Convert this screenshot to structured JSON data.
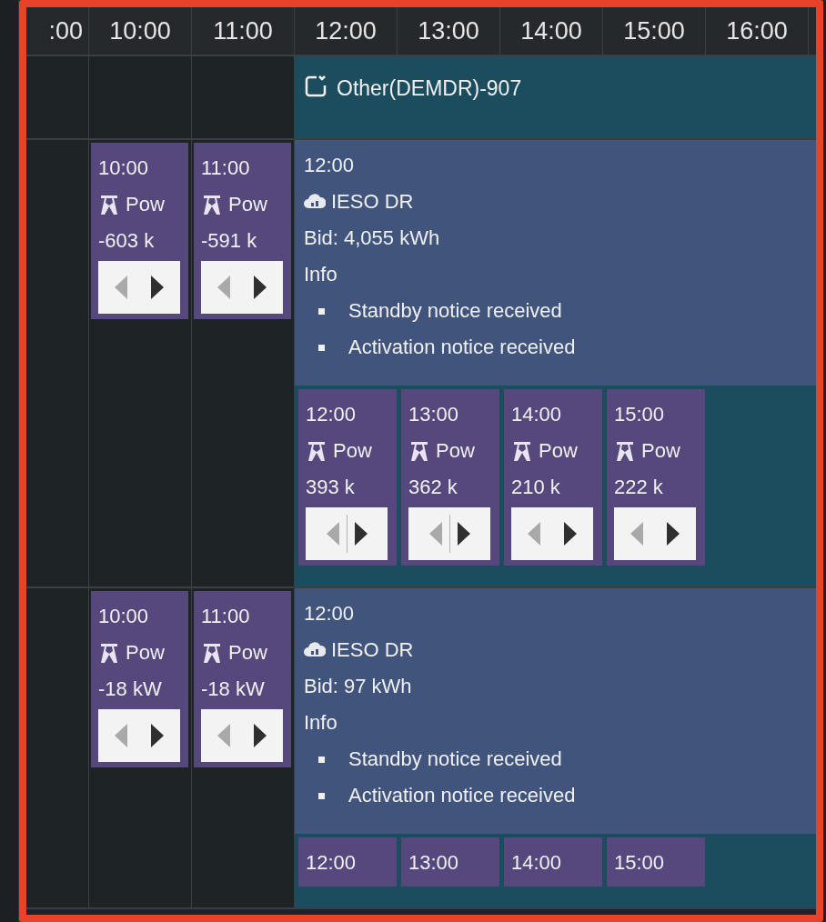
{
  "header": {
    "times": [
      ":00",
      "10:00",
      "11:00",
      "12:00",
      "13:00",
      "14:00",
      "15:00",
      "16:00"
    ]
  },
  "rows": [
    {
      "kind": "banner",
      "label": "Other(DEMDR)-907"
    },
    {
      "kind": "event",
      "pre_cards": [
        {
          "time": "10:00",
          "label": "Pow",
          "value": "-603 k",
          "nav": {
            "prev_disabled": true,
            "split": false
          }
        },
        {
          "time": "11:00",
          "label": "Pow",
          "value": "-591 k",
          "nav": {
            "prev_disabled": true,
            "split": false
          }
        }
      ],
      "event": {
        "time": "12:00",
        "name": "IESO DR",
        "bid": "Bid: 4,055 kWh",
        "info_label": "Info",
        "notes": [
          "Standby notice received",
          "Activation notice received"
        ]
      },
      "hourly": [
        {
          "time": "12:00",
          "label": "Pow",
          "value": "393 k",
          "nav": {
            "prev_disabled": true,
            "split": true
          }
        },
        {
          "time": "13:00",
          "label": "Pow",
          "value": "362 k",
          "nav": {
            "prev_disabled": true,
            "split": true
          }
        },
        {
          "time": "14:00",
          "label": "Pow",
          "value": "210 k",
          "nav": {
            "prev_disabled": true,
            "split": false
          }
        },
        {
          "time": "15:00",
          "label": "Pow",
          "value": "222 k",
          "nav": {
            "prev_disabled": true,
            "split": false
          }
        }
      ]
    },
    {
      "kind": "event",
      "pre_cards": [
        {
          "time": "10:00",
          "label": "Pow",
          "value": "-18 kW",
          "nav": {
            "prev_disabled": true,
            "split": false
          }
        },
        {
          "time": "11:00",
          "label": "Pow",
          "value": "-18 kW",
          "nav": {
            "prev_disabled": true,
            "split": false
          }
        }
      ],
      "event": {
        "time": "12:00",
        "name": "IESO DR",
        "bid": "Bid: 97 kWh",
        "info_label": "Info",
        "notes": [
          "Standby notice received",
          "Activation notice received"
        ]
      },
      "hourly": [
        {
          "time": "12:00"
        },
        {
          "time": "13:00"
        },
        {
          "time": "14:00"
        },
        {
          "time": "15:00"
        }
      ]
    }
  ]
}
